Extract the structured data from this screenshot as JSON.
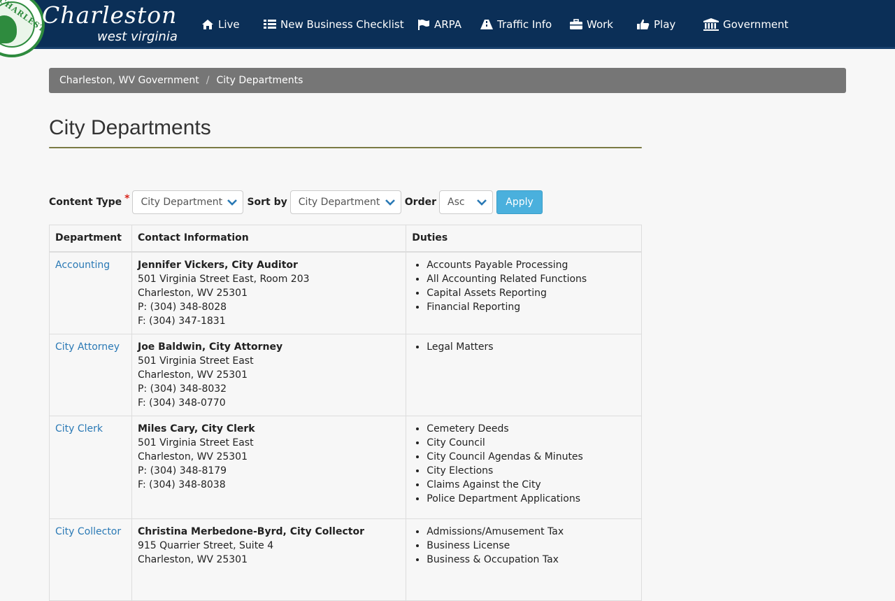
{
  "brand": {
    "title": "Charleston",
    "subtitle": "west virginia",
    "seal_text": "CHARLESTON"
  },
  "nav": [
    {
      "label": "Live",
      "icon": "home-icon"
    },
    {
      "label": "New Business Checklist",
      "icon": "list-icon"
    },
    {
      "label": "ARPA",
      "icon": "flag-icon"
    },
    {
      "label": "Traffic Info",
      "icon": "road-icon"
    },
    {
      "label": "Work",
      "icon": "briefcase-icon"
    },
    {
      "label": "Play",
      "icon": "thumbs-up-icon"
    },
    {
      "label": "Government",
      "icon": "institution-icon"
    }
  ],
  "breadcrumb": {
    "home": "Charleston, WV Government",
    "separator": "/",
    "current": "City Departments"
  },
  "page": {
    "title": "City Departments"
  },
  "filters": {
    "content_type_label": "Content Type",
    "required_mark": "*",
    "content_type_value": "City Department",
    "sort_by_label": "Sort by",
    "sort_by_value": "City Department",
    "order_label": "Order",
    "order_value": "Asc",
    "apply_label": "Apply"
  },
  "table": {
    "headers": [
      "Department",
      "Contact Information",
      "Duties"
    ],
    "rows": [
      {
        "department": "Accounting",
        "contact_name": "Jennifer Vickers, City Auditor",
        "address1": "501 Virginia Street East, Room 203",
        "address2": "Charleston, WV 25301",
        "phone": "P: (304) 348-8028",
        "fax": "F: (304) 347-1831",
        "duties": [
          "Accounts Payable Processing",
          "All Accounting Related Functions",
          "Capital Assets Reporting",
          "Financial Reporting"
        ]
      },
      {
        "department": "City Attorney",
        "contact_name": "Joe Baldwin, City Attorney",
        "address1": "501 Virginia Street East",
        "address2": "Charleston, WV 25301",
        "phone": "P: (304) 348-8032",
        "fax": "F: (304) 348-0770",
        "duties": [
          "Legal Matters"
        ]
      },
      {
        "department": "City Clerk",
        "contact_name": "Miles Cary, City Clerk",
        "address1": "501 Virginia Street East",
        "address2": "Charleston, WV 25301",
        "phone": "P: (304) 348-8179",
        "fax": "F: (304) 348-8038",
        "duties": [
          "Cemetery Deeds",
          "City Council",
          "City Council Agendas & Minutes",
          "City Elections",
          "Claims Against the City",
          "Police Department Applications"
        ]
      },
      {
        "department": "City Collector",
        "contact_name": "Christina Merbedone-Byrd, City Collector",
        "address1": "915 Quarrier Street, Suite 4",
        "address2": "Charleston, WV 25301",
        "phone": "",
        "fax": "",
        "duties": [
          "Admissions/Amusement Tax",
          "Business License",
          "Business & Occupation Tax"
        ]
      }
    ]
  },
  "colors": {
    "header_bg": "#0b2f57",
    "breadcrumb_bg": "#767676",
    "link": "#2a79b5",
    "apply_bg": "#4ab0dd",
    "seal_green": "#2e8b3e"
  }
}
